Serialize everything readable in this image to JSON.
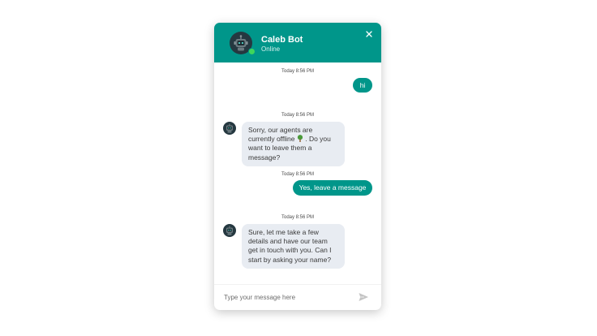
{
  "header": {
    "bot_name": "Caleb Bot",
    "status": "Online",
    "avatar_icon": "robot-icon",
    "close_icon": "close-icon",
    "brand_color": "#00968a"
  },
  "messages": [
    {
      "sender": "user",
      "timestamp": "Today 8:56 PM",
      "text": "hi"
    },
    {
      "sender": "bot",
      "timestamp": "Today 8:56 PM",
      "text_before_emoji": "Sorry, our agents are\ncurrently offline ",
      "emoji_icon": "tree-icon",
      "text_after_emoji": " . Do you\nwant to leave them a\nmessage?"
    },
    {
      "sender": "user",
      "timestamp": "Today 8:56 PM",
      "text": "Yes, leave a message"
    },
    {
      "sender": "bot",
      "timestamp": "Today 8:56 PM",
      "text": "Sure, let me take a few\ndetails and have our team\nget in touch with you. Can I\nstart by asking your name?"
    }
  ],
  "composer": {
    "placeholder": "Type your message here",
    "value": "",
    "send_icon": "send-icon"
  }
}
